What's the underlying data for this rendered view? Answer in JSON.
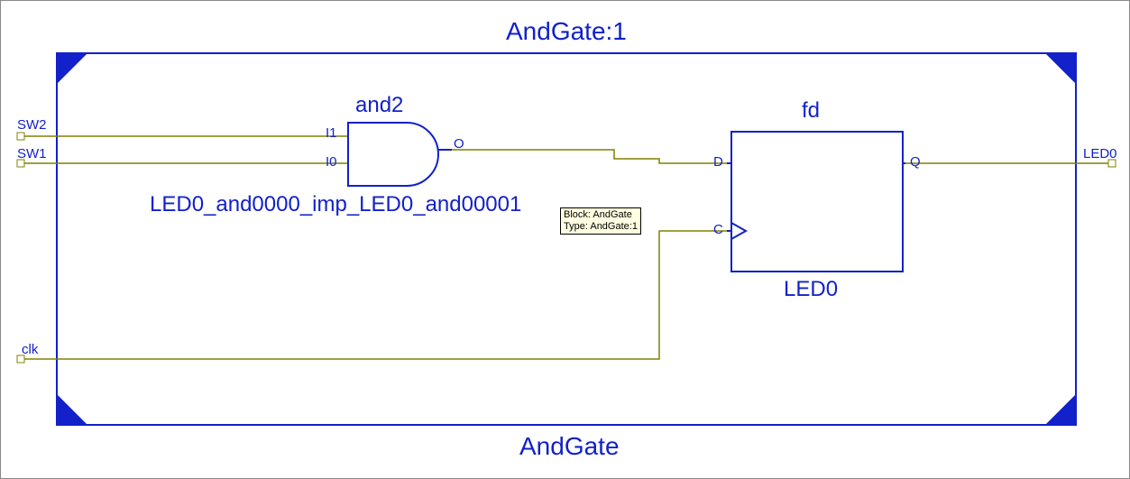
{
  "diagram": {
    "title_top": "AndGate:1",
    "title_bottom": "AndGate",
    "and_gate": {
      "type_label": "and2",
      "instance_label": "LED0_and0000_imp_LED0_and00001",
      "ports": {
        "in0": "I1",
        "in1": "I0",
        "out": "O"
      }
    },
    "flipflop": {
      "type_label": "fd",
      "instance_label": "LED0",
      "ports": {
        "d": "D",
        "c": "C",
        "q": "Q"
      }
    },
    "external_ports": {
      "sw2": "SW2",
      "sw1": "SW1",
      "clk": "clk",
      "led0": "LED0"
    },
    "tooltip": {
      "line1": "Block: AndGate",
      "line2": "Type: AndGate:1"
    }
  },
  "colors": {
    "frame_blue": "#1221c9",
    "wire_olive": "#808000",
    "tooltip_bg": "#ffffe1"
  }
}
